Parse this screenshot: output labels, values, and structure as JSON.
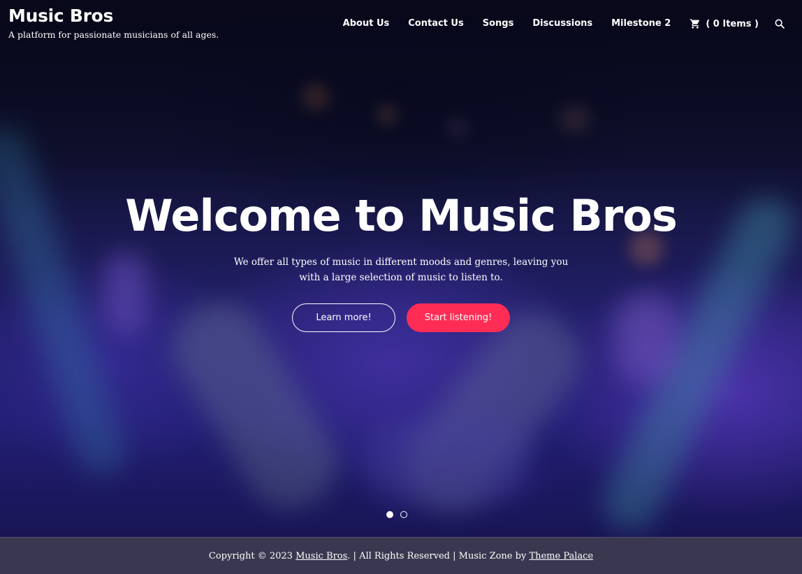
{
  "site": {
    "title": "Music Bros",
    "tagline": "A platform for passionate musicians of all ages."
  },
  "nav": {
    "items": [
      {
        "label": "About Us"
      },
      {
        "label": "Contact Us"
      },
      {
        "label": "Songs"
      },
      {
        "label": "Discussions"
      },
      {
        "label": "Milestone 2"
      }
    ],
    "cart_label": "( 0 Items )",
    "cart_icon": "cart-icon",
    "search_icon": "search-icon"
  },
  "hero": {
    "title": "Welcome to Music Bros",
    "description": "We offer all types of music in different moods and genres, leaving you with a large selection of music to listen to.",
    "primary_button": "Learn more!",
    "secondary_button": "Start listening!",
    "slides_total": 2,
    "slide_active": 1
  },
  "footer": {
    "copyright_prefix": "Copyright © 2023 ",
    "site_link": "Music Bros",
    "rights_text": ". | All Rights Reserved | Music Zone by ",
    "theme_link": "Theme Palace"
  },
  "colors": {
    "accent": "#ff2d55",
    "footer_bg": "#3a3850",
    "text": "#ffffff"
  }
}
